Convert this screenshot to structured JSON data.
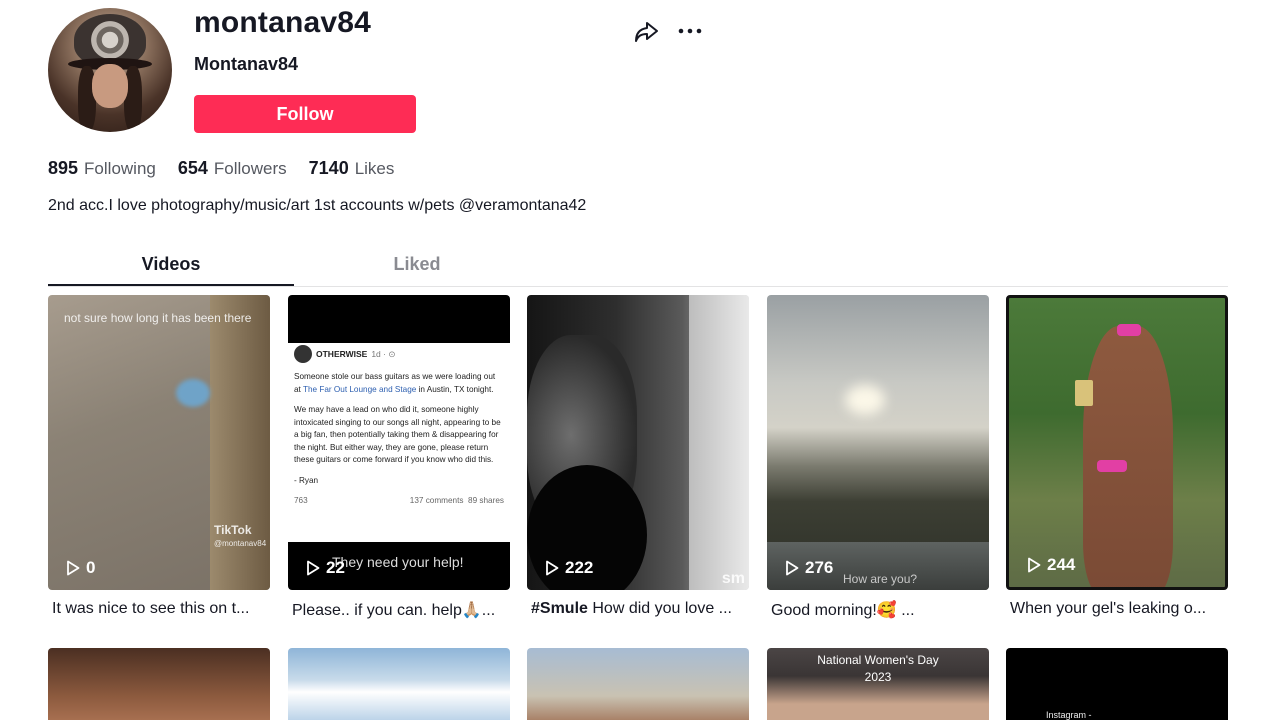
{
  "profile": {
    "username": "montanav84",
    "nickname": "Montanav84",
    "follow_label": "Follow",
    "stats": [
      {
        "value": "895",
        "label": "Following"
      },
      {
        "value": "654",
        "label": "Followers"
      },
      {
        "value": "7140",
        "label": "Likes"
      }
    ],
    "bio": "2nd acc.I love photography/music/art 1st accounts w/pets @veramontana42"
  },
  "actions": {
    "share_icon": "share-arrow-icon",
    "more_icon": "more-dots-icon"
  },
  "tabs": [
    {
      "label": "Videos",
      "active": true
    },
    {
      "label": "Liked",
      "active": false
    }
  ],
  "videos": [
    {
      "views": "0",
      "caption": "It was nice to see this on t...",
      "overlay": "not sure how long it has been there",
      "watermark": "TikTok",
      "handle": "@montanav84"
    },
    {
      "views": "22",
      "caption": "Please.. if you can. help🙏🏼...",
      "overlay": "They need your help!",
      "post": {
        "account": "OTHERWISE",
        "time": "1d · ⊙",
        "p1_a": "Someone stole our bass guitars as we were loading out at ",
        "p1_link": "The Far Out Lounge and Stage",
        "p1_b": " in Austin, TX tonight.",
        "p2": "We may have a lead on who did it, someone highly intoxicated singing to our songs all night, appearing to be a big fan, then potentially taking them & disappearing for the night. But either way, they are gone, please return these guitars or come forward if you know who did this.",
        "sign": "- Ryan",
        "reactions": "763",
        "comments": "137 comments",
        "shares": "89 shares"
      }
    },
    {
      "views": "222",
      "caption_tag": "#Smule",
      "caption": " How did you love ...",
      "overlay": "sm"
    },
    {
      "views": "276",
      "caption": "Good morning!🥰 ...",
      "overlay": "How are you?"
    },
    {
      "views": "244",
      "caption": "When your gel's leaking o..."
    }
  ],
  "row2": {
    "womens_day": "National Women's Day",
    "year": "2023",
    "ig_text": "Instagram -"
  },
  "colors": {
    "accent": "#fe2c55",
    "text": "#161823",
    "muted": "#8a8b91"
  }
}
